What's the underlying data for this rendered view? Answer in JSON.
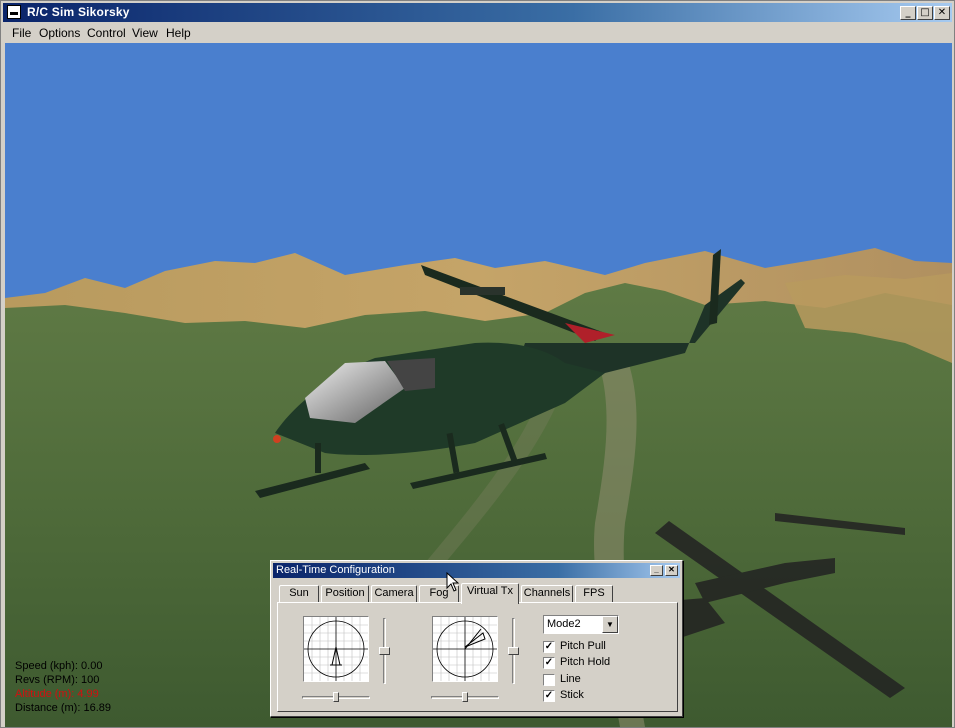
{
  "window": {
    "title": "R/C Sim Sikorsky",
    "buttons": {
      "minimize": "_",
      "maximize": "□",
      "close": "✕"
    }
  },
  "menu": [
    "File",
    "Options",
    "Control",
    "View",
    "Help"
  ],
  "hud": {
    "speed": "Speed (kph): 0.00",
    "revs": "Revs (RPM): 100",
    "altitude": "Altitude (m): 4.99",
    "distance": "Distance (m): 16.89"
  },
  "config": {
    "title": "Real-Time Configuration",
    "tabs": [
      "Sun",
      "Position",
      "Camera",
      "Fog",
      "Virtual Tx",
      "Channels",
      "FPS"
    ],
    "active_tab": "Virtual Tx",
    "mode_select": {
      "value": "Mode2"
    },
    "checkboxes": [
      {
        "label": "Pitch Pull",
        "checked": true
      },
      {
        "label": "Pitch Hold",
        "checked": true
      },
      {
        "label": "Line",
        "checked": false
      },
      {
        "label": "Stick",
        "checked": true
      }
    ],
    "sliders": {
      "left_vertical_level": 0.5,
      "right_vertical_level": 0.5,
      "left_horizontal_level": 0.5,
      "right_horizontal_level": 0.5
    }
  },
  "colors": {
    "sky": "#4a7fce",
    "title_active": "#0a246a",
    "hud_alert": "#d01010"
  }
}
